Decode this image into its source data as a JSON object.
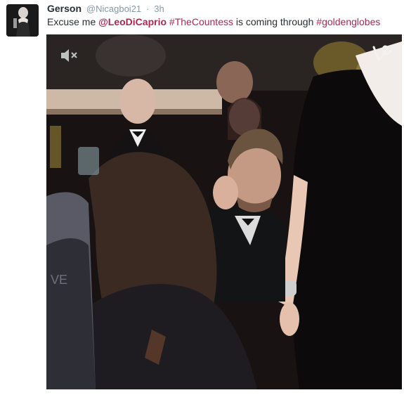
{
  "tweet": {
    "author_name": "Gerson",
    "author_handle": "@Nicagboi21",
    "separator": "·",
    "timestamp": "3h",
    "text_parts": {
      "prefix": "Excuse me ",
      "mention": "@LeoDiCaprio",
      "hashtag1": "#TheCountess",
      "middle": " is coming through ",
      "hashtag2": "#goldenglobes"
    }
  },
  "media": {
    "type": "video",
    "icons": [
      "mute-icon",
      "vine-logo-icon"
    ]
  },
  "colors": {
    "link": "#ad2852",
    "name": "#292f33",
    "meta": "#8899a6"
  }
}
